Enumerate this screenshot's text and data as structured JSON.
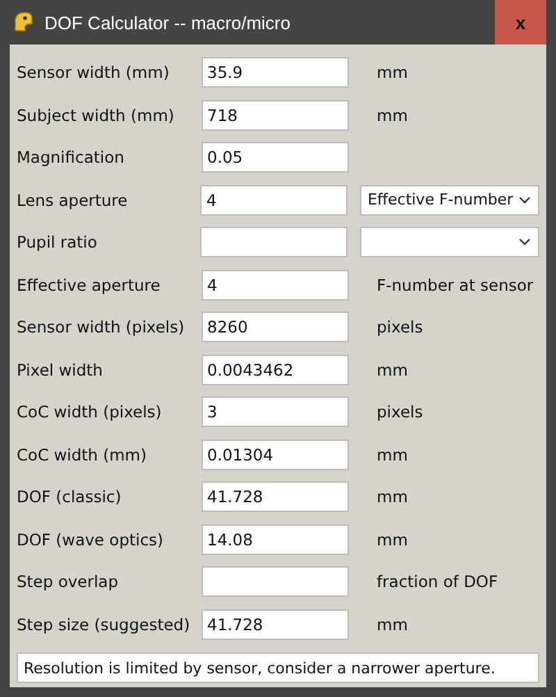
{
  "window": {
    "title": "DOF Calculator -- macro/micro",
    "close": "x"
  },
  "rows": [
    {
      "label": "Sensor width (mm)",
      "value": "35.9",
      "kind": "unit",
      "unit": "mm"
    },
    {
      "label": "Subject width (mm)",
      "value": "718",
      "kind": "unit",
      "unit": "mm"
    },
    {
      "label": "Magnification",
      "value": "0.05",
      "kind": "none"
    },
    {
      "label": "Lens aperture",
      "value": "4",
      "kind": "select",
      "select": "Effective F-number"
    },
    {
      "label": "Pupil ratio",
      "value": "",
      "kind": "select",
      "select": ""
    },
    {
      "label": "Effective aperture",
      "value": "4",
      "kind": "unit",
      "unit": "F-number at sensor"
    },
    {
      "label": "Sensor width (pixels)",
      "value": "8260",
      "kind": "unit",
      "unit": "pixels"
    },
    {
      "label": "Pixel width",
      "value": "0.0043462",
      "kind": "unit",
      "unit": "mm"
    },
    {
      "label": "CoC width (pixels)",
      "value": "3",
      "kind": "unit",
      "unit": "pixels"
    },
    {
      "label": "CoC width (mm)",
      "value": "0.01304",
      "kind": "unit",
      "unit": "mm"
    },
    {
      "label": "DOF (classic)",
      "value": "41.728",
      "kind": "unit",
      "unit": "mm"
    },
    {
      "label": "DOF (wave optics)",
      "value": "14.08",
      "kind": "unit",
      "unit": "mm"
    },
    {
      "label": "Step overlap",
      "value": "",
      "kind": "unit",
      "unit": "fraction of DOF"
    },
    {
      "label": "Step size (suggested)",
      "value": "41.728",
      "kind": "unit",
      "unit": "mm"
    }
  ],
  "status": "Resolution is limited by sensor, consider a narrower aperture."
}
